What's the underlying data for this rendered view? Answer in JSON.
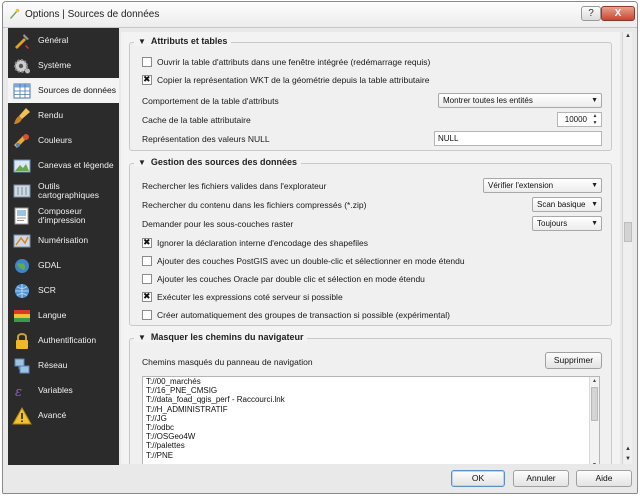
{
  "window": {
    "title": "Options | Sources de données",
    "help_button": "?",
    "close_button": "X"
  },
  "sidebar": {
    "items": [
      {
        "label": "Général",
        "icon": "tools-icon"
      },
      {
        "label": "Système",
        "icon": "gear-icon"
      },
      {
        "label": "Sources de données",
        "icon": "table-icon",
        "active": true
      },
      {
        "label": "Rendu",
        "icon": "paintbrush-icon"
      },
      {
        "label": "Couleurs",
        "icon": "palette-icon"
      },
      {
        "label": "Canevas et légende",
        "icon": "canvas-icon"
      },
      {
        "label": "Outils cartographiques",
        "icon": "map-tools-icon"
      },
      {
        "label": "Composeur\nd'impression",
        "icon": "composer-icon"
      },
      {
        "label": "Numérisation",
        "icon": "digitize-icon"
      },
      {
        "label": "GDAL",
        "icon": "globe-icon"
      },
      {
        "label": "SCR",
        "icon": "crs-globe-icon"
      },
      {
        "label": "Langue",
        "icon": "flag-icon"
      },
      {
        "label": "Authentification",
        "icon": "lock-icon"
      },
      {
        "label": "Réseau",
        "icon": "network-icon"
      },
      {
        "label": "Variables",
        "icon": "variables-icon"
      },
      {
        "label": "Avancé",
        "icon": "warning-icon"
      }
    ]
  },
  "attributes": {
    "title": "Attributs et tables",
    "open_docked": "Ouvrir la table d'attributs dans une fenêtre intégrée (redémarrage requis)",
    "copy_wkt": "Copier la représentation WKT de la géométrie depuis la table attributaire",
    "behavior_label": "Comportement de la table d'attributs",
    "behavior_value": "Montrer toutes les entités",
    "cache_label": "Cache de la table attributaire",
    "cache_value": "10000",
    "null_label": "Représentation des valeurs NULL",
    "null_value": "NULL"
  },
  "sources": {
    "title": "Gestion des sources des données",
    "scan_label": "Rechercher les fichiers valides dans l'explorateur",
    "scan_value": "Vérifier l'extension",
    "zip_label": "Rechercher du contenu dans les fichiers compressés (*.zip)",
    "zip_value": "Scan basique",
    "sublayers_label": "Demander pour les sous-couches raster",
    "sublayers_value": "Toujours",
    "ignore_encoding": "Ignorer la déclaration interne d'encodage des shapefiles",
    "postgis_dblclick": "Ajouter des couches PostGIS avec un double-clic et sélectionner en mode étendu",
    "oracle_dblclick": "Ajouter les couches Oracle par double clic et sélection en mode étendu",
    "server_expr": "Exécuter les expressions coté serveur si possible",
    "transaction_groups": "Créer automatiquement des groupes de transaction si possible (expérimental)"
  },
  "browser": {
    "title": "Masquer les chemins du navigateur",
    "hidden_label": "Chemins masqués du panneau de navigation",
    "remove_button": "Supprimer",
    "paths": [
      "T://00_marchés",
      "T://16_PNE_CMSIG",
      "T://data_foad_qgis_perf - Raccourci.lnk",
      "T://H_ADMINISTRATIF",
      "T://JG",
      "T://odbc",
      "T://OSGeo4W",
      "T://palettes",
      "T://PNE"
    ]
  },
  "footer": {
    "ok": "OK",
    "cancel": "Annuler",
    "help": "Aide"
  },
  "colors": {
    "sidebar_bg": "#2b2b2b",
    "active_item_bg": "#f4f4f4",
    "close_button": "#c9452f"
  }
}
